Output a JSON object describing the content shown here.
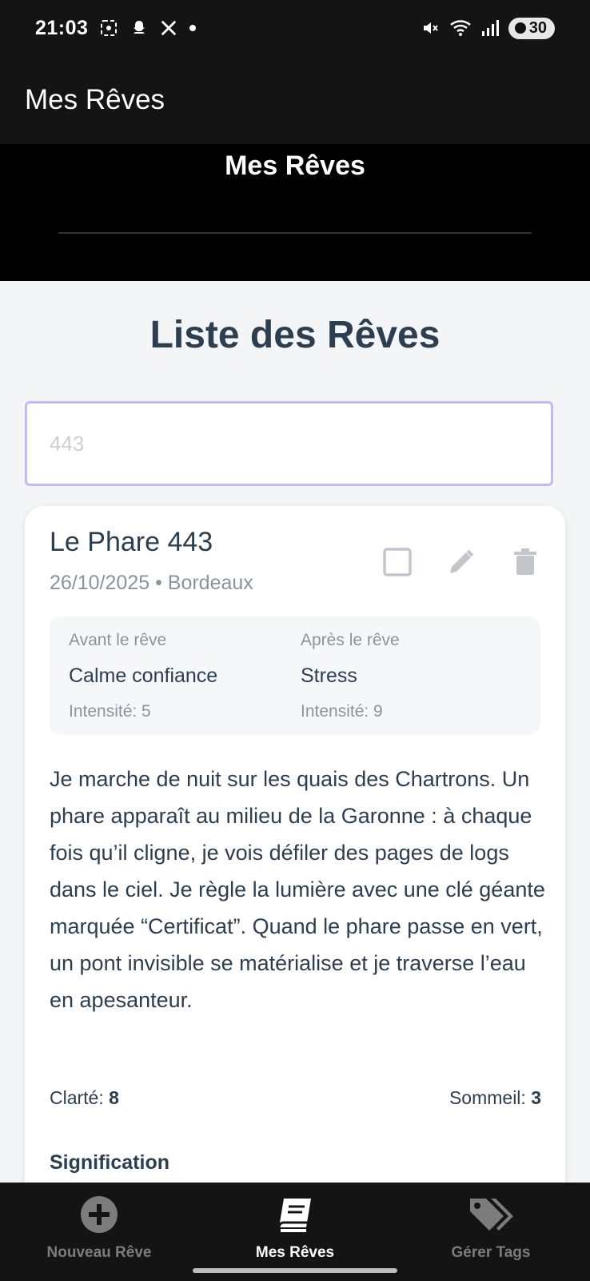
{
  "status_bar": {
    "time": "21:03",
    "battery": "30"
  },
  "app_bar": {
    "title": "Mes Rêves"
  },
  "header": {
    "title": "Mes Rêves"
  },
  "main": {
    "list_title": "Liste des Rêves",
    "search": {
      "placeholder": "443"
    },
    "card": {
      "title": "Le Phare 443",
      "meta": "26/10/2025 • Bordeaux",
      "before": {
        "label": "Avant le rêve",
        "value": "Calme confiance",
        "intensity": "Intensité: 5"
      },
      "after": {
        "label": "Après le rêve",
        "value": "Stress",
        "intensity": "Intensité: 9"
      },
      "text": "Je marche de nuit sur les quais des Chartrons. Un phare apparaît au milieu de la Garonne : à chaque fois qu’il cligne, je vois défiler des pages de logs dans le ciel. Je règle la lumière avec une clé géante marquée “Certificat”. Quand le phare passe en vert, un pont invisible se matérialise et je traverse l’eau en apesanteur.",
      "clarity_label": "Clarté:",
      "clarity_value": "8",
      "sleep_label": "Sommeil:",
      "sleep_value": "3",
      "signification": "Signification"
    }
  },
  "bottom_nav": {
    "items": [
      {
        "label": "Nouveau Rêve",
        "icon": "add-circle-icon"
      },
      {
        "label": "Mes Rêves",
        "icon": "book-icon"
      },
      {
        "label": "Gérer Tags",
        "icon": "tags-icon"
      }
    ]
  },
  "colors": {
    "accent_border": "#c6b8f2",
    "text_dark": "#2c3e50",
    "text_muted": "#8a949e"
  }
}
